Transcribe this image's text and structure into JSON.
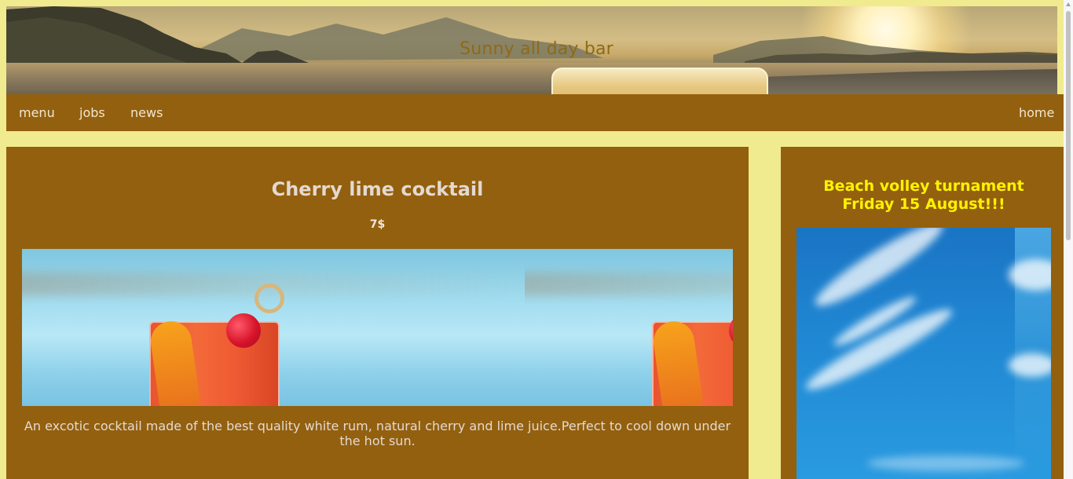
{
  "header": {
    "site_title": "Sunny all day bar",
    "banner_image": "sunset-beach-cocktail-banner"
  },
  "nav": {
    "items": [
      {
        "label": "menu"
      },
      {
        "label": "jobs"
      },
      {
        "label": "news"
      }
    ],
    "home_label": "home"
  },
  "main": {
    "title": "Cherry lime cocktail",
    "price": "7$",
    "image": "cherry-lime-cocktail-photo",
    "description": "An excotic cocktail made of the best quality white rum, natural cherry and lime juice.Perfect to cool down under the hot sun."
  },
  "sidebar": {
    "announcement_line1": "Beach volley turnament",
    "announcement_line2": "Friday 15 August!!!",
    "image": "blue-sky-photo"
  },
  "colors": {
    "page_background": "#f0eb8e",
    "card_background": "#93600f",
    "title_text": "#e4d9d0",
    "announcement_text": "#fff200",
    "site_title_text": "#8e6a16"
  }
}
